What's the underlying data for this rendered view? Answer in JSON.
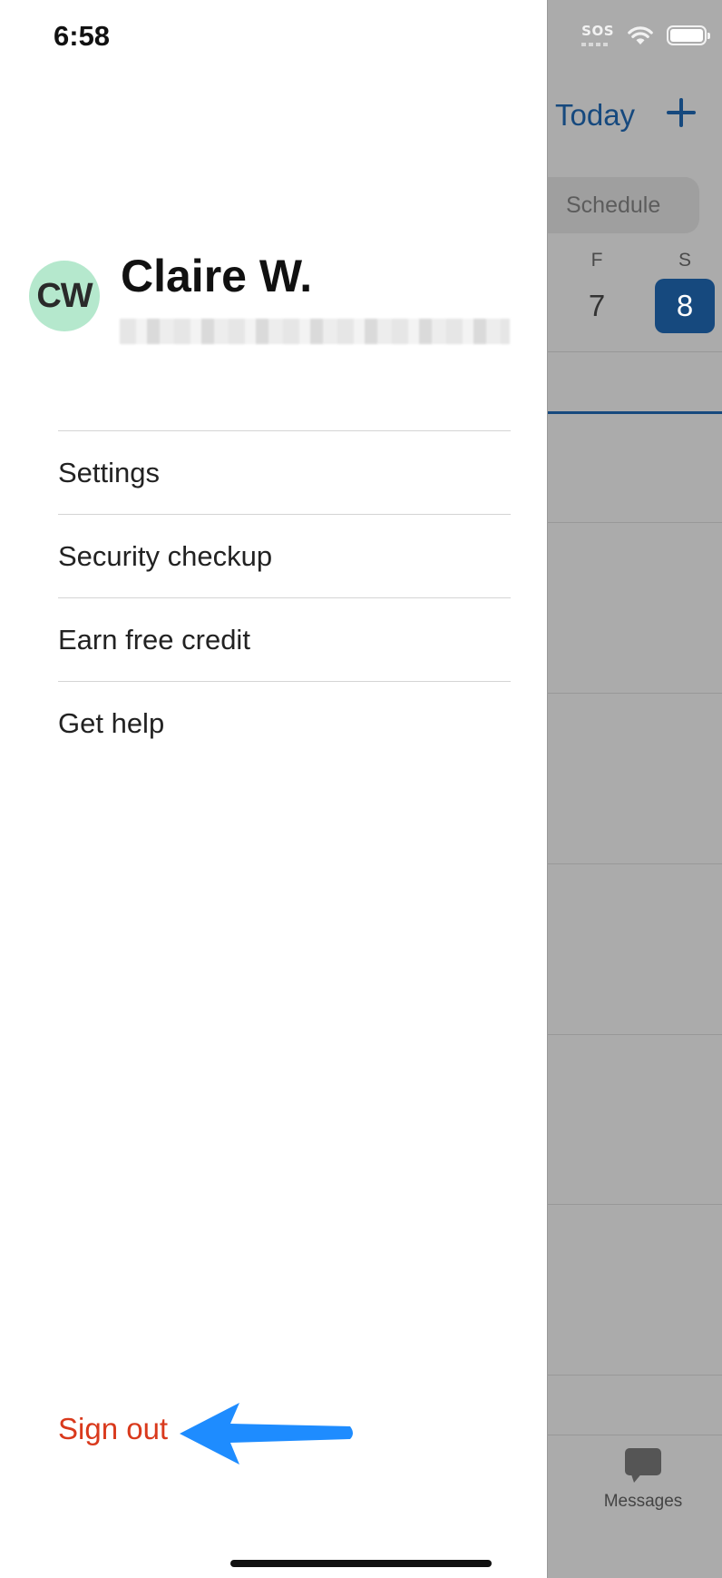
{
  "status_bar": {
    "time": "6:58",
    "carrier": "SOS"
  },
  "background_app": {
    "today_label": "Today",
    "schedule_label": "Schedule",
    "days": [
      {
        "letter": "F",
        "number": "7",
        "selected": false
      },
      {
        "letter": "S",
        "number": "8",
        "selected": true
      }
    ],
    "messages_label": "Messages"
  },
  "drawer": {
    "avatar_initials": "CW",
    "user_name": "Claire W.",
    "menu": [
      {
        "label": "Settings"
      },
      {
        "label": "Security checkup"
      },
      {
        "label": "Earn free credit"
      },
      {
        "label": "Get help"
      }
    ],
    "sign_out_label": "Sign out"
  },
  "colors": {
    "accent": "#16497e",
    "sign_out": "#d9391c",
    "avatar_bg": "#b5e8cd",
    "annotation_arrow": "#1e8cff"
  }
}
